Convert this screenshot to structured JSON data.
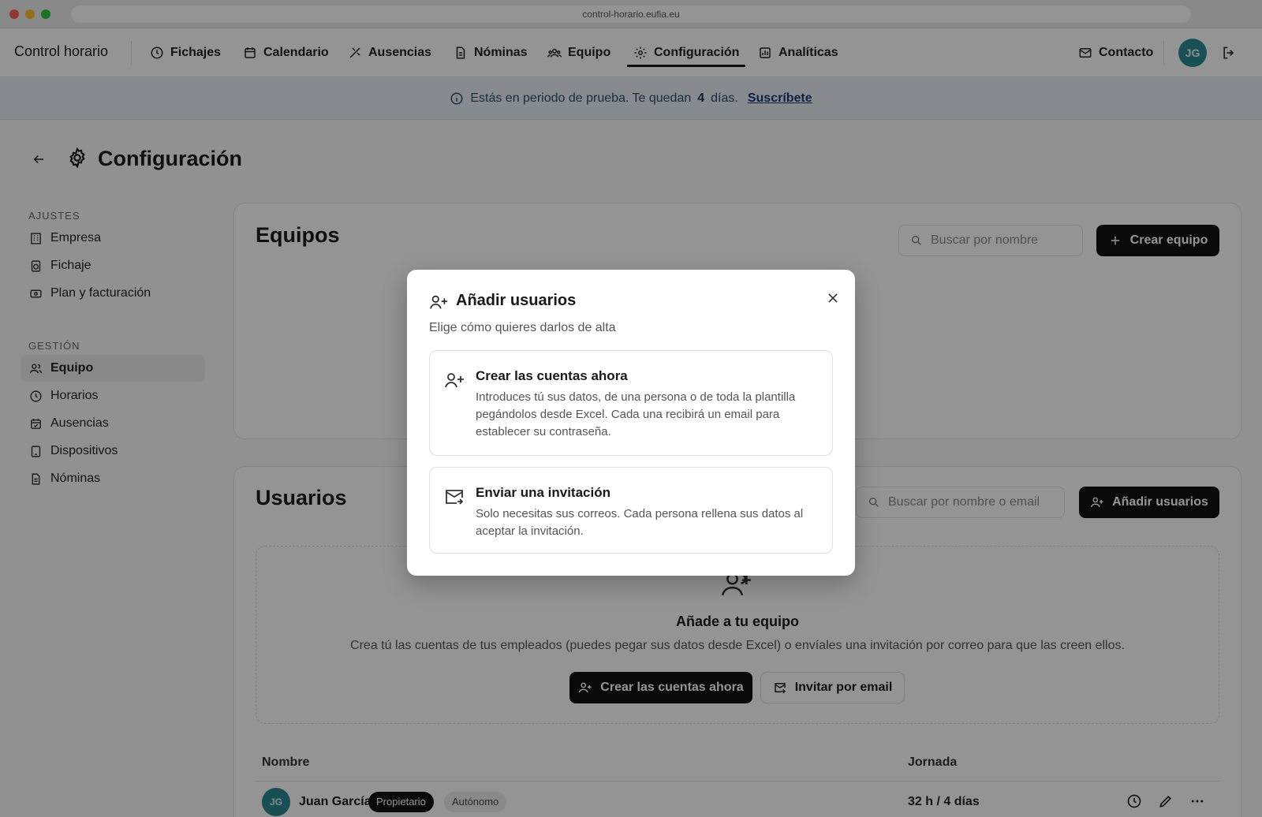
{
  "browser": {
    "url": "control-horario.eufia.eu"
  },
  "nav": {
    "brand": "Control horario",
    "items": [
      {
        "label": "Fichajes",
        "icon": "clock-icon"
      },
      {
        "label": "Calendario",
        "icon": "calendar-icon"
      },
      {
        "label": "Ausencias",
        "icon": "plane-icon"
      },
      {
        "label": "Nóminas",
        "icon": "document-icon"
      },
      {
        "label": "Equipo",
        "icon": "team-icon"
      },
      {
        "label": "Configuración",
        "icon": "gear-icon",
        "active": true
      },
      {
        "label": "Analíticas",
        "icon": "chart-icon"
      }
    ],
    "contact": "Contacto",
    "avatar_initials": "JG"
  },
  "trial": {
    "text_before": "Estás en periodo de prueba. Te quedan",
    "days": "4",
    "text_after": "días.",
    "cta": "Suscríbete"
  },
  "page": {
    "title": "Configuración"
  },
  "sidebar": {
    "sections": [
      {
        "heading": "AJUSTES",
        "items": [
          {
            "label": "Empresa"
          },
          {
            "label": "Fichaje"
          },
          {
            "label": "Plan y facturación"
          }
        ]
      },
      {
        "heading": "GESTIÓN",
        "items": [
          {
            "label": "Equipo",
            "active": true
          },
          {
            "label": "Horarios"
          },
          {
            "label": "Ausencias"
          },
          {
            "label": "Dispositivos"
          },
          {
            "label": "Nóminas"
          }
        ]
      }
    ]
  },
  "teams": {
    "title": "Equipos",
    "search_placeholder": "Buscar por nombre",
    "create_button": "Crear equipo"
  },
  "users": {
    "title": "Usuarios",
    "search_placeholder": "Buscar por nombre o email",
    "add_button": "Añadir usuarios",
    "empty_title": "Añade a tu equipo",
    "empty_desc": "Crea tú las cuentas de tus empleados (puedes pegar sus datos desde Excel) o envíales una invitación por correo para que las creen ellos.",
    "create_now_button": "Crear las cuentas ahora",
    "invite_button": "Invitar por email",
    "columns": {
      "name": "Nombre",
      "schedule": "Jornada"
    },
    "rows": [
      {
        "initials": "JG",
        "name": "Juan García",
        "badge_role": "Propietario",
        "badge_type": "Autónomo",
        "schedule": "32 h / 4 días"
      }
    ]
  },
  "modal": {
    "title": "Añadir usuarios",
    "subtitle": "Elige cómo quieres darlos de alta",
    "options": [
      {
        "title": "Crear las cuentas ahora",
        "desc": "Introduces tú sus datos, de una persona o de toda la plantilla pegándolos desde Excel. Cada una recibirá un email para establecer su contraseña."
      },
      {
        "title": "Enviar una invitación",
        "desc": "Solo necesitas sus correos. Cada persona rellena sus datos al aceptar la invitación."
      }
    ]
  },
  "colors": {
    "accent_dark": "#111111",
    "avatar": "#2a8a93",
    "trial_bg": "#e8f0f8",
    "link": "#17376e"
  }
}
